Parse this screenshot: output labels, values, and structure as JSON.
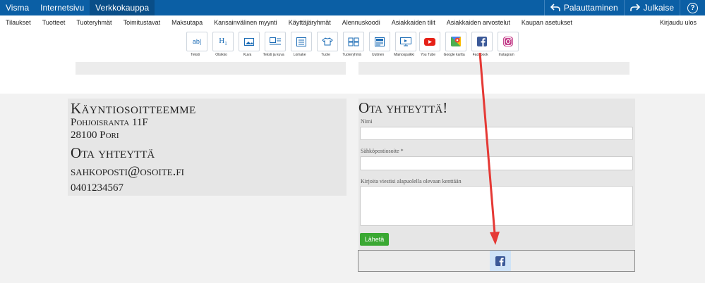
{
  "topbar": {
    "tabs": [
      "Visma",
      "Internetsivu",
      "Verkkokauppa"
    ],
    "restore_label": "Palauttaminen",
    "publish_label": "Julkaise",
    "help_label": "?"
  },
  "menu": {
    "items": [
      "Tilaukset",
      "Tuotteet",
      "Tuoteryhmät",
      "Toimitustavat",
      "Maksutapa",
      "Kansainvälinen myynti",
      "Käyttäjäryhmät",
      "Alennuskoodi",
      "Asiakkaiden tilit",
      "Asiakkaiden arvostelut",
      "Kaupan asetukset"
    ],
    "logout": "Kirjaudu ulos"
  },
  "tools": [
    {
      "label": "Teksti",
      "icon": "text-icon"
    },
    {
      "label": "Otsikko",
      "icon": "heading-icon"
    },
    {
      "label": "Kuva",
      "icon": "image-icon"
    },
    {
      "label": "Teksti ja kuva",
      "icon": "text-image-icon"
    },
    {
      "label": "Lomake",
      "icon": "form-icon"
    },
    {
      "label": "Tuote",
      "icon": "product-icon"
    },
    {
      "label": "Tuoteryhmä",
      "icon": "product-group-icon"
    },
    {
      "label": "Uutinen",
      "icon": "news-icon"
    },
    {
      "label": "Mainospaikki",
      "icon": "ad-slot-icon"
    },
    {
      "label": "You Tube",
      "icon": "youtube-icon"
    },
    {
      "label": "Google kartta",
      "icon": "google-maps-icon"
    },
    {
      "label": "Facebook",
      "icon": "facebook-icon"
    },
    {
      "label": "Instagram",
      "icon": "instagram-icon"
    }
  ],
  "address": {
    "title": "Käyntiosoitteemme",
    "street": "Pohjoisranta 11F",
    "city": "28100 Pori",
    "contact_title": "Ota yhteyttä",
    "email": "sahkoposti@osoite.fi",
    "phone": "0401234567"
  },
  "form": {
    "title": "Ota yhteyttä!",
    "name_label": "Nimi",
    "email_label": "Sähköpostiosoite *",
    "message_label": "Kirjoita viestisi alapuolella olevaan kenttään",
    "send_label": "Lähetä"
  },
  "colors": {
    "topbar": "#0b5fa5",
    "send_button": "#3aa832",
    "facebook": "#3b5998",
    "arrow": "#e53935"
  }
}
